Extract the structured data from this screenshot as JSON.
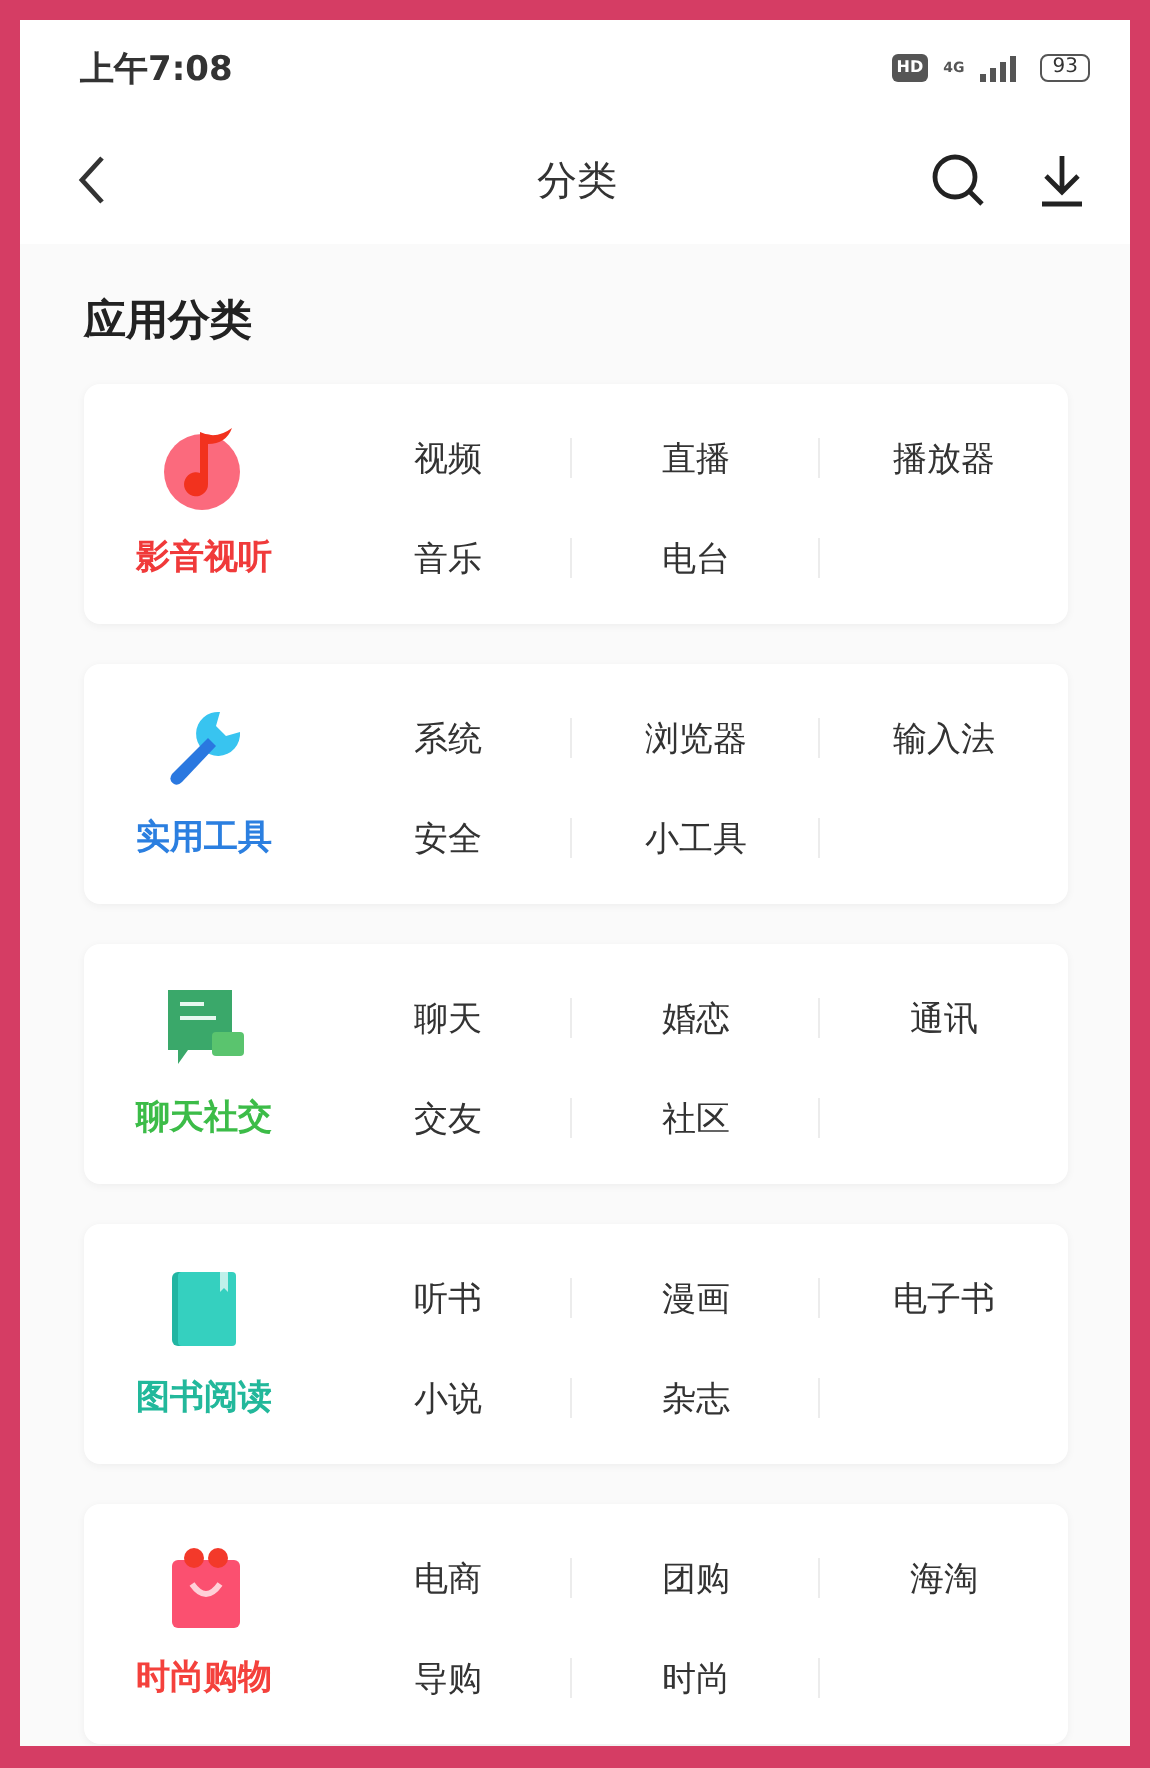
{
  "status_bar": {
    "time": "上午7:08",
    "hd": "HD",
    "network": "4G",
    "battery": "93"
  },
  "nav": {
    "title": "分类"
  },
  "section": {
    "title": "应用分类"
  },
  "groups": [
    {
      "label": "影音视听",
      "kind": "music",
      "color": "#f03a3a",
      "rows": [
        [
          "视频",
          "直播",
          "播放器"
        ],
        [
          "音乐",
          "电台"
        ]
      ]
    },
    {
      "label": "实用工具",
      "kind": "wrench",
      "color": "#2b7fe0",
      "rows": [
        [
          "系统",
          "浏览器",
          "输入法"
        ],
        [
          "安全",
          "小工具"
        ]
      ]
    },
    {
      "label": "聊天社交",
      "kind": "chat",
      "color": "#3cbc48",
      "rows": [
        [
          "聊天",
          "婚恋",
          "通讯"
        ],
        [
          "交友",
          "社区"
        ]
      ]
    },
    {
      "label": "图书阅读",
      "kind": "book",
      "color": "#22b89b",
      "rows": [
        [
          "听书",
          "漫画",
          "电子书"
        ],
        [
          "小说",
          "杂志"
        ]
      ]
    },
    {
      "label": "时尚购物",
      "kind": "bag",
      "color": "#f4413c",
      "rows": [
        [
          "电商",
          "团购",
          "海淘"
        ],
        [
          "导购",
          "时尚"
        ]
      ]
    }
  ]
}
